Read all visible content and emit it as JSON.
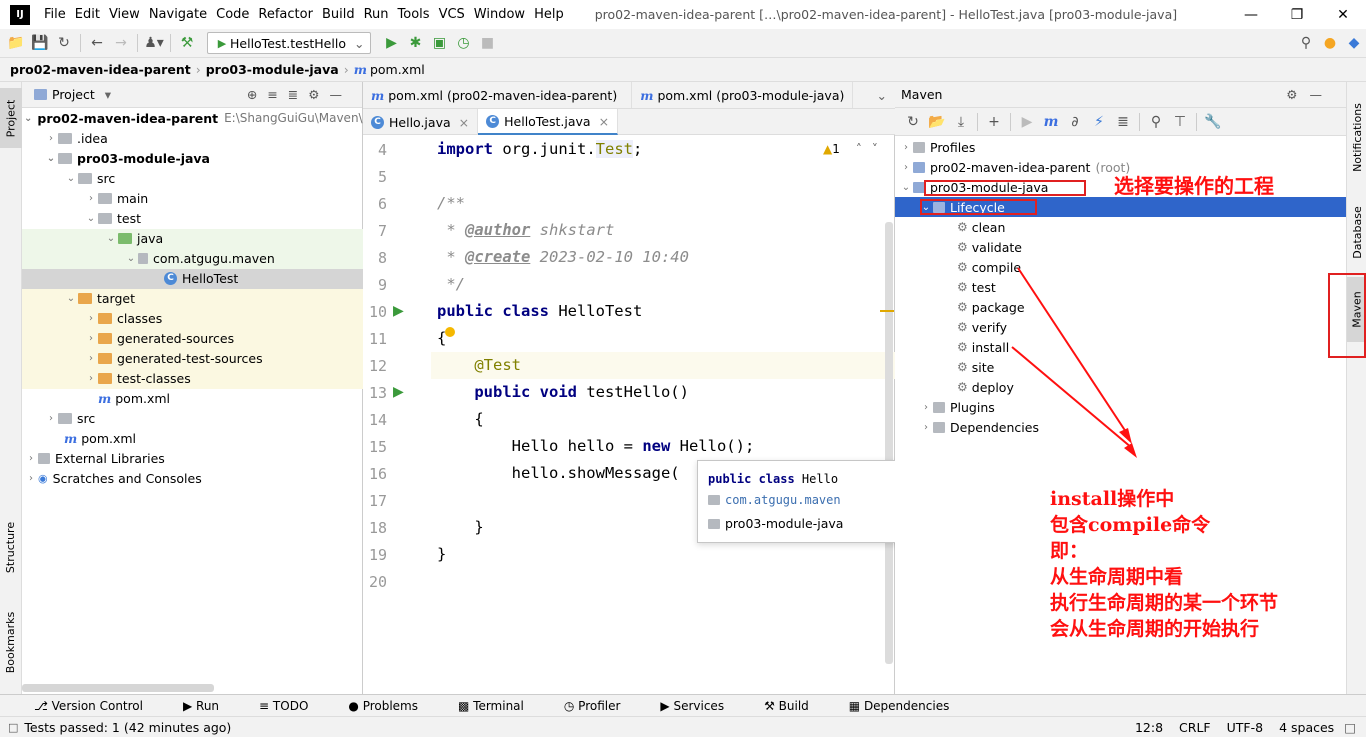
{
  "app": {
    "logo_text": "IJ",
    "window_title": "pro02-maven-idea-parent […\\pro02-maven-idea-parent] - HelloTest.java [pro03-module-java]"
  },
  "menu": [
    "File",
    "Edit",
    "View",
    "Navigate",
    "Code",
    "Refactor",
    "Build",
    "Run",
    "Tools",
    "VCS",
    "Window",
    "Help"
  ],
  "toolbar": {
    "run_config": "HelloTest.testHello"
  },
  "breadcrumb": [
    "pro02-maven-idea-parent",
    "pro03-module-java",
    "pom.xml"
  ],
  "left_strip": {
    "project": "Project",
    "structure": "Structure",
    "bookmarks": "Bookmarks"
  },
  "project": {
    "header": "Project",
    "root_path": "E:\\ShangGuiGu\\Maven\\i",
    "items": [
      {
        "label": "pro02-maven-idea-parent"
      },
      {
        "label": ".idea"
      },
      {
        "label": "pro03-module-java"
      },
      {
        "label": "src"
      },
      {
        "label": "main"
      },
      {
        "label": "test"
      },
      {
        "label": "java"
      },
      {
        "label": "com.atgugu.maven"
      },
      {
        "label": "HelloTest"
      },
      {
        "label": "target"
      },
      {
        "label": "classes"
      },
      {
        "label": "generated-sources"
      },
      {
        "label": "generated-test-sources"
      },
      {
        "label": "test-classes"
      },
      {
        "label": "pom.xml"
      },
      {
        "label": "src"
      },
      {
        "label": "pom.xml"
      },
      {
        "label": "External Libraries"
      },
      {
        "label": "Scratches and Consoles"
      }
    ]
  },
  "editor": {
    "tabs_row1": [
      "pom.xml (pro02-maven-idea-parent)",
      "pom.xml (pro03-module-java)"
    ],
    "tabs_row2": [
      "Hello.java",
      "HelloTest.java"
    ],
    "warning_count": "1",
    "line_numbers": [
      "4",
      "5",
      "6",
      "7",
      "8",
      "9",
      "10",
      "11",
      "12",
      "13",
      "14",
      "15",
      "16",
      "17",
      "18",
      "19",
      "20"
    ],
    "code": {
      "l4_import": "import",
      "l4_rest": " org.junit.",
      "l4_test": "Test",
      "l4_semi": ";",
      "l6": "/**",
      "l7_star": " * ",
      "l7_tag": "@author",
      "l7_val": " shkstart",
      "l8_star": " * ",
      "l8_tag": "@create",
      "l8_val": " 2023-02-10 10:40",
      "l9": " */",
      "l10_kw": "public class",
      "l10_name": " HelloTest",
      "l11": "{",
      "l12": "    @Test",
      "l13_kw": "    public void",
      "l13_name": " testHello()",
      "l14": "    {",
      "l15_a": "        Hello hello = ",
      "l15_kw": "new",
      "l15_b": " Hello();",
      "l16": "        hello.showMessage(",
      "l18": "    }",
      "l19": "}"
    },
    "popup": {
      "kw": "public class",
      "name": " Hello",
      "package": "com.atgugu.maven",
      "module": "pro03-module-java"
    }
  },
  "maven": {
    "header": "Maven",
    "items": [
      "Profiles",
      "pro02-maven-idea-parent",
      "(root)",
      "pro03-module-java",
      "Lifecycle",
      "clean",
      "validate",
      "compile",
      "test",
      "package",
      "verify",
      "install",
      "site",
      "deploy",
      "Plugins",
      "Dependencies"
    ]
  },
  "right_strip": {
    "notifications": "Notifications",
    "database": "Database",
    "maven": "Maven"
  },
  "annotations": {
    "select_project": "选择要操作的工程",
    "note_lines": [
      "install操作中",
      "包含compile命令",
      "即：",
      "从生命周期中看",
      "执行生命周期的某一个环节",
      "会从生命周期的开始执行"
    ]
  },
  "bottom_tabs": [
    "Version Control",
    "Run",
    "TODO",
    "Problems",
    "Terminal",
    "Profiler",
    "Services",
    "Build",
    "Dependencies"
  ],
  "status": {
    "left": "Tests passed: 1 (42 minutes ago)",
    "position": "12:8",
    "line_sep": "CRLF",
    "encoding": "UTF-8",
    "indent": "4 spaces"
  },
  "colors": {
    "selection": "#2f65ca",
    "annotation_red": "#ff1010"
  }
}
